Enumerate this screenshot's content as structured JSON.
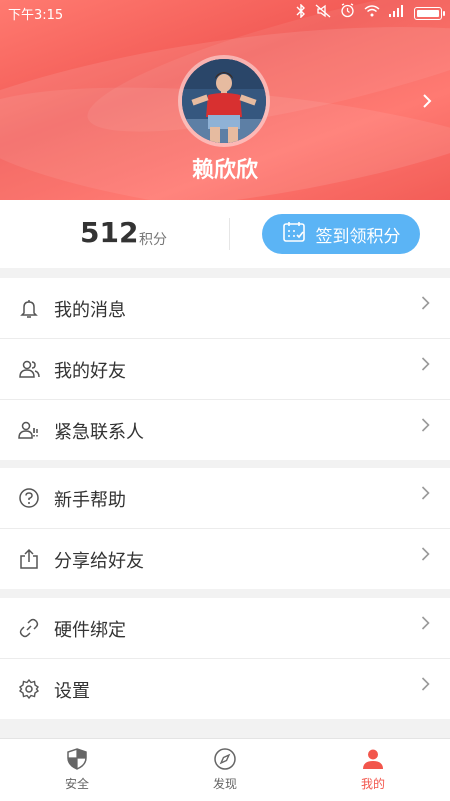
{
  "status_bar": {
    "time": "下午3:15",
    "icons": [
      "bluetooth-icon",
      "mute-icon",
      "alarm-icon",
      "wifi-icon",
      "signal-icon",
      "battery-icon"
    ]
  },
  "profile": {
    "name": "赖欣欣"
  },
  "points": {
    "value": "512",
    "unit": "积分",
    "checkin_label": "签到领积分"
  },
  "groups": [
    [
      {
        "label": "我的消息",
        "icon": "bell-icon"
      },
      {
        "label": "我的好友",
        "icon": "friends-icon"
      },
      {
        "label": "紧急联系人",
        "icon": "emergency-contact-icon"
      }
    ],
    [
      {
        "label": "新手帮助",
        "icon": "help-icon"
      },
      {
        "label": "分享给好友",
        "icon": "share-icon"
      }
    ],
    [
      {
        "label": "硬件绑定",
        "icon": "link-icon"
      },
      {
        "label": "设置",
        "icon": "gear-icon"
      }
    ]
  ],
  "tabs": [
    {
      "label": "安全",
      "icon": "shield-icon"
    },
    {
      "label": "发现",
      "icon": "compass-icon"
    },
    {
      "label": "我的",
      "icon": "person-icon"
    }
  ],
  "colors": {
    "header": "#f25a55",
    "checkin_button": "#5bb4f5",
    "active_tab": "#f2564c"
  }
}
